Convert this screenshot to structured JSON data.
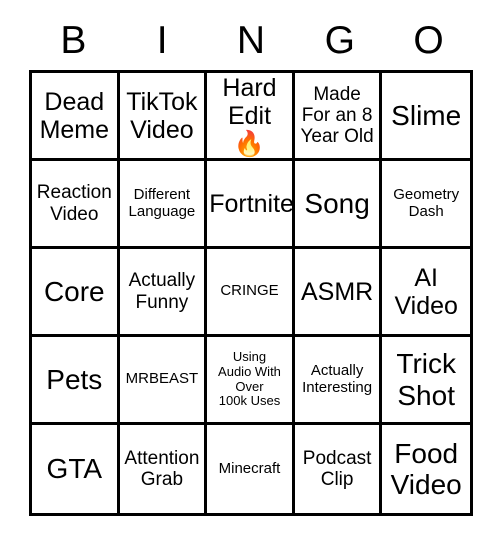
{
  "card": {
    "title": "BINGO",
    "background_color": "#ffffff",
    "border_color": "#000000",
    "text_color": "#000000",
    "headers": [
      "B",
      "I",
      "N",
      "G",
      "O"
    ],
    "rows": [
      [
        {
          "label": "Dead\nMeme",
          "size": "lg"
        },
        {
          "label": "TikTok\nVideo",
          "size": "lg"
        },
        {
          "label": "Hard\nEdit 🔥",
          "size": "lg",
          "has_emoji": true,
          "emoji": "🔥"
        },
        {
          "label": "Made\nFor an 8\nYear Old",
          "size": "md"
        },
        {
          "label": "Slime",
          "size": "xl"
        }
      ],
      [
        {
          "label": "Reaction\nVideo",
          "size": "md"
        },
        {
          "label": "Different\nLanguage",
          "size": "sm"
        },
        {
          "label": "Fortnite",
          "size": "lg"
        },
        {
          "label": "Song",
          "size": "xl"
        },
        {
          "label": "Geometry\nDash",
          "size": "sm"
        }
      ],
      [
        {
          "label": "Core",
          "size": "xl"
        },
        {
          "label": "Actually\nFunny",
          "size": "md"
        },
        {
          "label": "CRINGE",
          "size": "sm"
        },
        {
          "label": "ASMR",
          "size": "lg"
        },
        {
          "label": "AI\nVideo",
          "size": "lg"
        }
      ],
      [
        {
          "label": "Pets",
          "size": "xl"
        },
        {
          "label": "MRBEAST",
          "size": "sm"
        },
        {
          "label": "Using\nAudio With\nOver\n100k Uses",
          "size": "xs"
        },
        {
          "label": "Actually\nInteresting",
          "size": "sm"
        },
        {
          "label": "Trick\nShot",
          "size": "xl"
        }
      ],
      [
        {
          "label": "GTA",
          "size": "xl"
        },
        {
          "label": "Attention\nGrab",
          "size": "md"
        },
        {
          "label": "Minecraft",
          "size": "sm"
        },
        {
          "label": "Podcast\nClip",
          "size": "md"
        },
        {
          "label": "Food\nVideo",
          "size": "xl"
        }
      ]
    ]
  }
}
